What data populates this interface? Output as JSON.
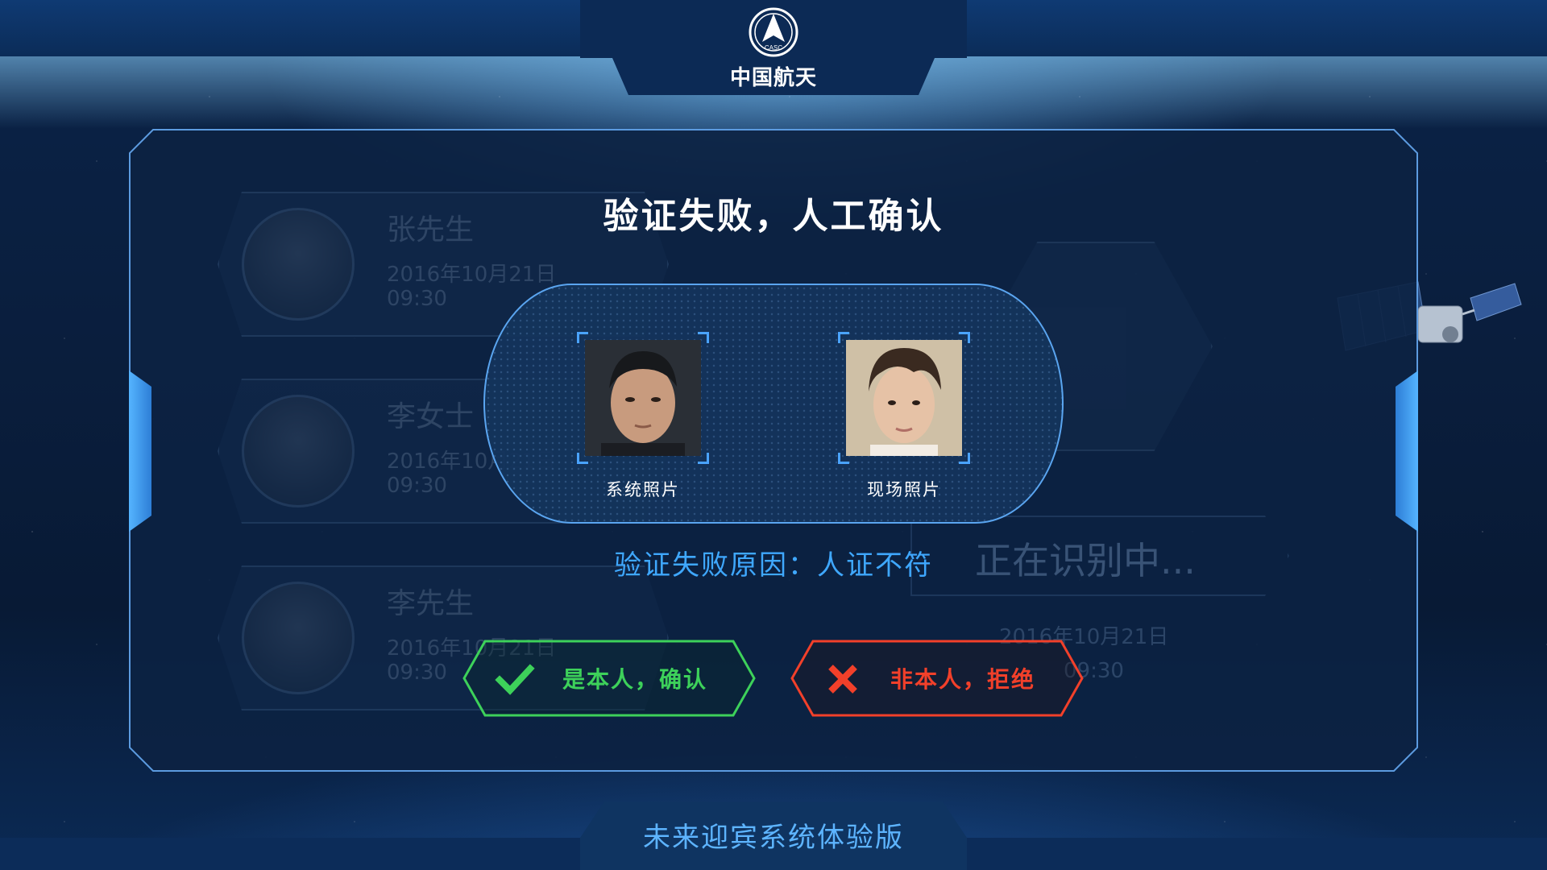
{
  "header": {
    "logo_caption": "中国航天",
    "logo_badge_text": "CASC"
  },
  "dialog": {
    "title": "验证失败，人工确认",
    "system_photo_label": "系统照片",
    "live_photo_label": "现场照片",
    "failure_reason": "验证失败原因：人证不符",
    "confirm_button": "是本人，确认",
    "reject_button": "非本人，拒绝"
  },
  "background_cards": [
    {
      "name": "张先生",
      "date": "2016年10月21日",
      "time": "09:30"
    },
    {
      "name": "李女士",
      "date": "2016年10月21日",
      "time": "09:30"
    },
    {
      "name": "李先生",
      "date": "2016年10月21日",
      "time": "09:30"
    }
  ],
  "background_status": {
    "text": "正在识别中...",
    "date": "2016年10月21日",
    "time": "09:30"
  },
  "footer": {
    "title": "未来迎宾系统体验版"
  },
  "colors": {
    "accent": "#3fa8ff",
    "confirm": "#3dd15a",
    "reject": "#f2402a",
    "panel_border": "#4f8fd6"
  }
}
